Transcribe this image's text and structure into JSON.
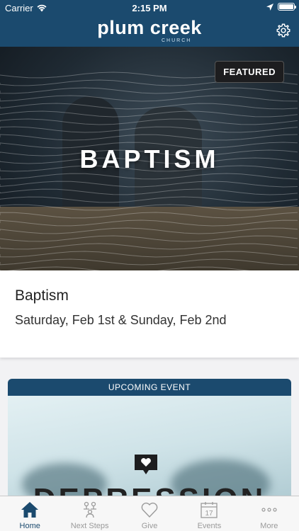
{
  "status_bar": {
    "carrier": "Carrier",
    "time": "2:15 PM",
    "battery_percent": 100
  },
  "header": {
    "logo_main": "plum creek",
    "logo_sub": "CHURCH",
    "settings_icon": "gear-icon"
  },
  "featured": {
    "badge": "FEATURED",
    "image_title": "BAPTISM",
    "title": "Baptism",
    "date": "Saturday, Feb 1st & Sunday, Feb 2nd"
  },
  "upcoming_event": {
    "header": "UPCOMING EVENT",
    "image_title": "DEPRESSION",
    "icon": "heart-speech-bubble-icon"
  },
  "tab_bar": {
    "tabs": [
      {
        "label": "Home",
        "icon": "home-icon",
        "active": true
      },
      {
        "label": "Next Steps",
        "icon": "next-steps-icon",
        "active": false
      },
      {
        "label": "Give",
        "icon": "heart-icon",
        "active": false
      },
      {
        "label": "Events",
        "icon": "calendar-icon",
        "active": false,
        "calendar_day": "17"
      },
      {
        "label": "More",
        "icon": "more-dots-icon",
        "active": false
      }
    ]
  },
  "colors": {
    "brand_blue": "#1b4a6e",
    "tab_inactive": "#9a9a9a"
  }
}
